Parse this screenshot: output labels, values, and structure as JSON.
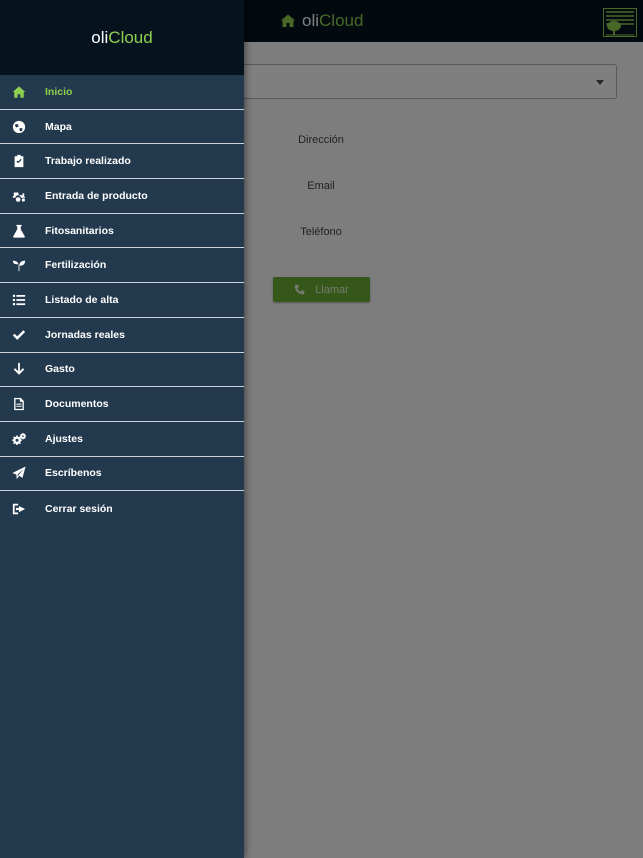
{
  "brand": {
    "prefix": "oli",
    "accent": "Cloud"
  },
  "colors": {
    "accent": "#8fd14f",
    "drawer": "#23394d",
    "header": "#05131e",
    "button": "#6aae32"
  },
  "main": {
    "fields": [
      {
        "label": "Dirección"
      },
      {
        "label": "Email"
      },
      {
        "label": "Teléfono"
      }
    ],
    "call_button": {
      "label": "Llamar",
      "icon": "phone-icon"
    }
  },
  "menu": {
    "items": [
      {
        "label": "Inicio",
        "icon": "home-icon",
        "active": true
      },
      {
        "label": "Mapa",
        "icon": "globe-icon"
      },
      {
        "label": "Trabajo realizado",
        "icon": "clipboard-check-icon"
      },
      {
        "label": "Entrada de producto",
        "icon": "tractor-icon"
      },
      {
        "label": "Fitosanitarios",
        "icon": "flask-icon"
      },
      {
        "label": "Fertilización",
        "icon": "seedling-icon"
      },
      {
        "label": "Listado de alta",
        "icon": "list-icon"
      },
      {
        "label": "Jornadas reales",
        "icon": "check-icon"
      },
      {
        "label": "Gasto",
        "icon": "arrow-down-icon"
      },
      {
        "label": "Documentos",
        "icon": "document-icon"
      },
      {
        "label": "Ajustes",
        "icon": "cogs-icon"
      },
      {
        "label": "Escríbenos",
        "icon": "paper-plane-icon"
      },
      {
        "label": "Cerrar sesión",
        "icon": "sign-out-icon"
      }
    ]
  }
}
